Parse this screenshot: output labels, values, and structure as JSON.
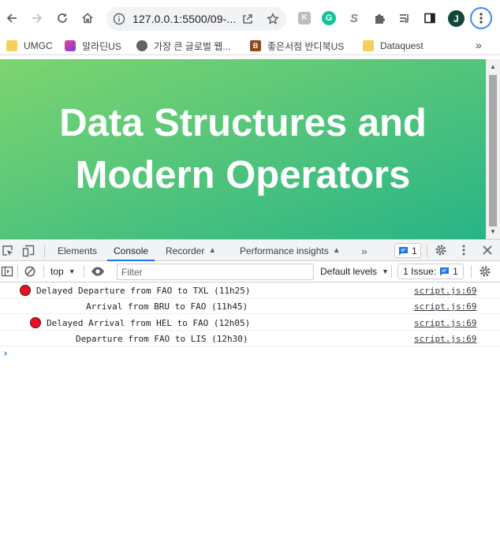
{
  "browser": {
    "url": "127.0.0.1:5500/09-...",
    "profile_initial": "J",
    "extension_icons": [
      "keep-icon",
      "grammarly-icon",
      "s-extension-icon",
      "puzzle-icon",
      "reading-list-icon",
      "side-panel-icon"
    ]
  },
  "bookmarks": [
    {
      "label": "UMGC",
      "icon": "folder-icon"
    },
    {
      "label": "알라딘US",
      "icon": "aladin-icon"
    },
    {
      "label": "가장 큰 글로벌 웹...",
      "icon": "globe-icon"
    },
    {
      "label": "좋은서점 반디북US",
      "icon": "bandi-icon"
    },
    {
      "label": "Dataquest",
      "icon": "folder-icon"
    }
  ],
  "page": {
    "heading_line1": "Data Structures and",
    "heading_line2": "Modern Operators"
  },
  "devtools": {
    "tabs": [
      "Elements",
      "Console",
      "Recorder",
      "Performance insights"
    ],
    "active_tab": "Console",
    "message_count": "1",
    "context": "top",
    "filter_placeholder": "Filter",
    "levels": "Default levels",
    "issues_label": "1 Issue:",
    "issues_count": "1",
    "logs": [
      {
        "message": "Delayed Departure from FAO to TXL (11h25)",
        "source": "script.js:69",
        "marker": "red-circle"
      },
      {
        "message": "Arrival from BRU to FAO (11h45)",
        "source": "script.js:69",
        "marker": ""
      },
      {
        "message": "Delayed Arrival from HEL to FAO (12h05)",
        "source": "script.js:69",
        "marker": "red-circle"
      },
      {
        "message": "Departure from FAO to LIS (12h30)",
        "source": "script.js:69",
        "marker": ""
      }
    ]
  },
  "colors": {
    "hero_gradient_start": "#7dd56f",
    "hero_gradient_end": "#28b487",
    "devtools_accent": "#1a73e8",
    "log_circle": "#e81123"
  }
}
